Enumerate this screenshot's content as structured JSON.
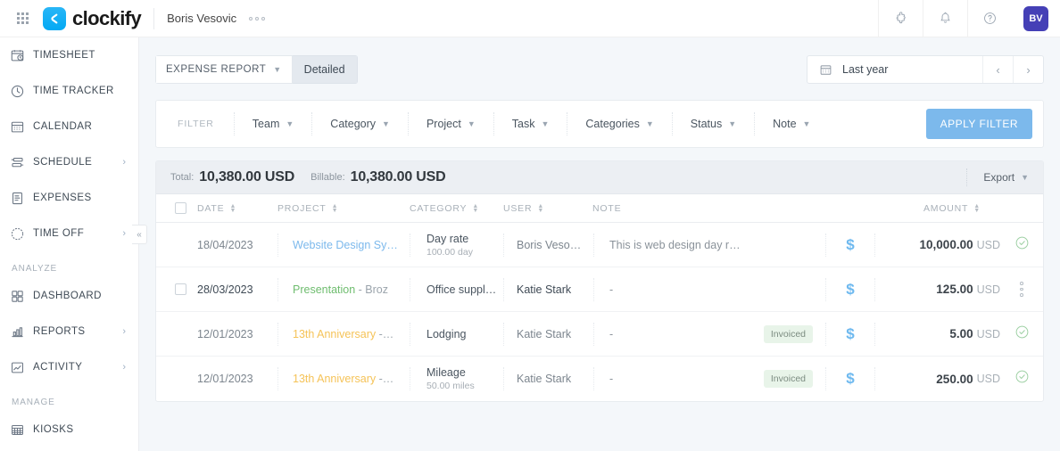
{
  "topbar": {
    "grid_icon": "apps-grid-icon",
    "brand": "clockify",
    "workspace": "Boris Vesovic",
    "more_icon": "more-horizontal-icon",
    "puzzle_icon": "puzzle-icon",
    "bell_icon": "bell-icon",
    "help_icon": "help-icon",
    "avatar_initials": "BV"
  },
  "sidebar": {
    "items": [
      {
        "label": "TIMESHEET",
        "icon": "timesheet-icon",
        "expandable": false
      },
      {
        "label": "TIME TRACKER",
        "icon": "clock-icon",
        "expandable": false
      },
      {
        "label": "CALENDAR",
        "icon": "calendar-icon",
        "expandable": false
      },
      {
        "label": "SCHEDULE",
        "icon": "schedule-icon",
        "expandable": true
      },
      {
        "label": "EXPENSES",
        "icon": "expenses-icon",
        "expandable": false
      },
      {
        "label": "TIME OFF",
        "icon": "time-off-icon",
        "expandable": true
      }
    ],
    "group_analyze": "ANALYZE",
    "analyze_items": [
      {
        "label": "DASHBOARD",
        "icon": "dashboard-icon",
        "expandable": false
      },
      {
        "label": "REPORTS",
        "icon": "reports-icon",
        "expandable": true
      },
      {
        "label": "ACTIVITY",
        "icon": "activity-icon",
        "expandable": true
      }
    ],
    "group_manage": "MANAGE",
    "manage_items": [
      {
        "label": "KIOSKS",
        "icon": "kiosks-icon",
        "expandable": false
      }
    ],
    "collapse_label": "«"
  },
  "toolbar": {
    "report_type": "EXPENSE REPORT",
    "report_tab": "Detailed",
    "date_range": "Last year",
    "prev_label": "‹",
    "next_label": "›"
  },
  "filter": {
    "label": "FILTER",
    "items": [
      "Team",
      "Category",
      "Project",
      "Task",
      "Categories",
      "Status",
      "Note"
    ],
    "apply_label": "APPLY FILTER"
  },
  "totals": {
    "total_key": "Total:",
    "total_value": "10,380.00 USD",
    "billable_key": "Billable:",
    "billable_value": "10,380.00 USD",
    "export_label": "Export"
  },
  "table": {
    "columns": {
      "date": "DATE",
      "project": "PROJECT",
      "category": "CATEGORY",
      "user": "USER",
      "note": "NOTE",
      "amount": "AMOUNT"
    },
    "rows": [
      {
        "date": "18/04/2023",
        "date_strong": false,
        "show_checkbox": false,
        "project": "Website Design Sy…",
        "project_color": "#7cb9ec",
        "project_sub": "",
        "category": "Day rate",
        "category_sub": "100.00 day",
        "user": "Boris Veso…",
        "user_strong": false,
        "note": "This is web design day r…",
        "badge": "",
        "billable_icon": "dollar-icon",
        "amount": "10,000.00",
        "currency": "USD",
        "action_icon": "check-circle-icon"
      },
      {
        "date": "28/03/2023",
        "date_strong": true,
        "show_checkbox": true,
        "project": "Presentation",
        "project_color": "#6fbd6f",
        "project_sub": "- Broz",
        "category": "Office suppl…",
        "category_sub": "",
        "user": "Katie Stark",
        "user_strong": true,
        "note": "-",
        "badge": "",
        "billable_icon": "dollar-icon",
        "amount": "125.00",
        "currency": "USD",
        "action_icon": "more-vertical-icon"
      },
      {
        "date": "12/01/2023",
        "date_strong": false,
        "show_checkbox": false,
        "project": "13th Anniversary",
        "project_color": "#f5c358",
        "project_sub": "-…",
        "category": "Lodging",
        "category_sub": "",
        "user": "Katie Stark",
        "user_strong": false,
        "note": "-",
        "badge": "Invoiced",
        "billable_icon": "dollar-icon",
        "amount": "5.00",
        "currency": "USD",
        "action_icon": "check-circle-icon"
      },
      {
        "date": "12/01/2023",
        "date_strong": false,
        "show_checkbox": false,
        "project": "13th Anniversary",
        "project_color": "#f5c358",
        "project_sub": "-…",
        "category": "Mileage",
        "category_sub": "50.00 miles",
        "user": "Katie Stark",
        "user_strong": false,
        "note": "-",
        "badge": "Invoiced",
        "billable_icon": "dollar-icon",
        "amount": "250.00",
        "currency": "USD",
        "action_icon": "check-circle-icon"
      }
    ]
  }
}
